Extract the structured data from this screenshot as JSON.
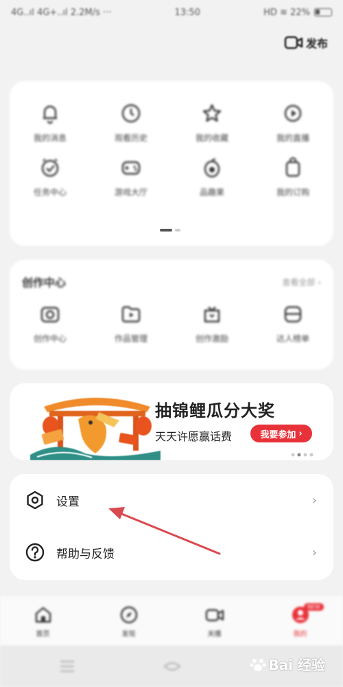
{
  "status_bar": {
    "left": "4G..ıl 4G+..ıl 2.2M/s ···",
    "time": "13:50",
    "right": "HD ≋ 22%"
  },
  "header": {
    "publish_label": "发布",
    "publish_icon": "video-camera-icon"
  },
  "quick_grid": {
    "items": [
      {
        "label": "我的消息",
        "icon": "bell-icon"
      },
      {
        "label": "观看历史",
        "icon": "clock-icon"
      },
      {
        "label": "我的收藏",
        "icon": "star-icon"
      },
      {
        "label": "我的直播",
        "icon": "live-icon"
      },
      {
        "label": "任务中心",
        "icon": "alarm-check-icon"
      },
      {
        "label": "游戏大厅",
        "icon": "gamepad-icon"
      },
      {
        "label": "品趣果",
        "icon": "melon-icon"
      },
      {
        "label": "我的订购",
        "icon": "bag-icon"
      }
    ]
  },
  "creator": {
    "title": "创作中心",
    "more": "查看全部 ›",
    "items": [
      {
        "label": "创作中心",
        "icon": "camera-icon"
      },
      {
        "label": "作品管理",
        "icon": "folder-play-icon"
      },
      {
        "label": "创作激励",
        "icon": "gift-icon"
      },
      {
        "label": "达人榜单",
        "icon": "bowl-icon"
      }
    ]
  },
  "banner": {
    "title": "抽锦鲤瓜分大奖",
    "subtitle": "天天许愿赢话费",
    "button": "我要参加",
    "button_arrow": "›"
  },
  "menu": {
    "settings": {
      "label": "设置",
      "icon": "settings-hexagon-icon",
      "chevron": "›"
    },
    "help": {
      "label": "帮助与反馈",
      "icon": "help-circle-icon",
      "chevron": "›"
    }
  },
  "tabbar": {
    "tabs": [
      {
        "label": "首页",
        "icon": "home-icon"
      },
      {
        "label": "发现",
        "icon": "compass-icon"
      },
      {
        "label": "关播",
        "icon": "video-icon"
      },
      {
        "label": "我的",
        "icon": "avatar-icon"
      }
    ],
    "badge": "NEW",
    "active_color": "#e8323a"
  },
  "watermark": {
    "text": "Bai 经验",
    "icon": "paw-icon"
  },
  "colors": {
    "accent": "#e8323a",
    "card": "#ffffff",
    "background": "#f2f2f2"
  }
}
